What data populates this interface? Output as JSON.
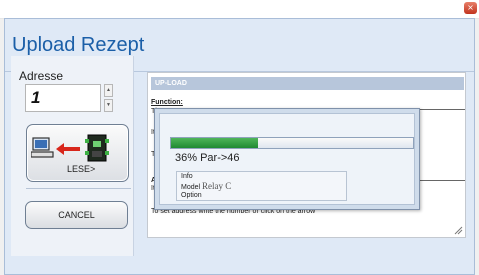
{
  "window": {
    "title": "Upload Rezept",
    "close_glyph": "×"
  },
  "left_panel": {
    "address_label": "Adresse",
    "address_value": "1",
    "lese_button_label": "LESE>",
    "cancel_button_label": "CANCEL",
    "icons": [
      "computer-icon",
      "arrow-left-icon",
      "device-icon"
    ]
  },
  "content": {
    "section_title": "UP-LOAD",
    "function_heading": "Function:",
    "function_text": "Th",
    "line_its": "It's",
    "line_to": "To",
    "heading_ad": "Ad",
    "line_it": "It c",
    "line_bottom": "To set address write the number or click on the arrow"
  },
  "progress_dialog": {
    "progress_fraction": 0.36,
    "status_text": "36% Par->46",
    "info_label": "Info",
    "model_label": "Model",
    "model_value": "Relay C",
    "option_label": "Option",
    "accent_color": "#2a9a3c"
  }
}
